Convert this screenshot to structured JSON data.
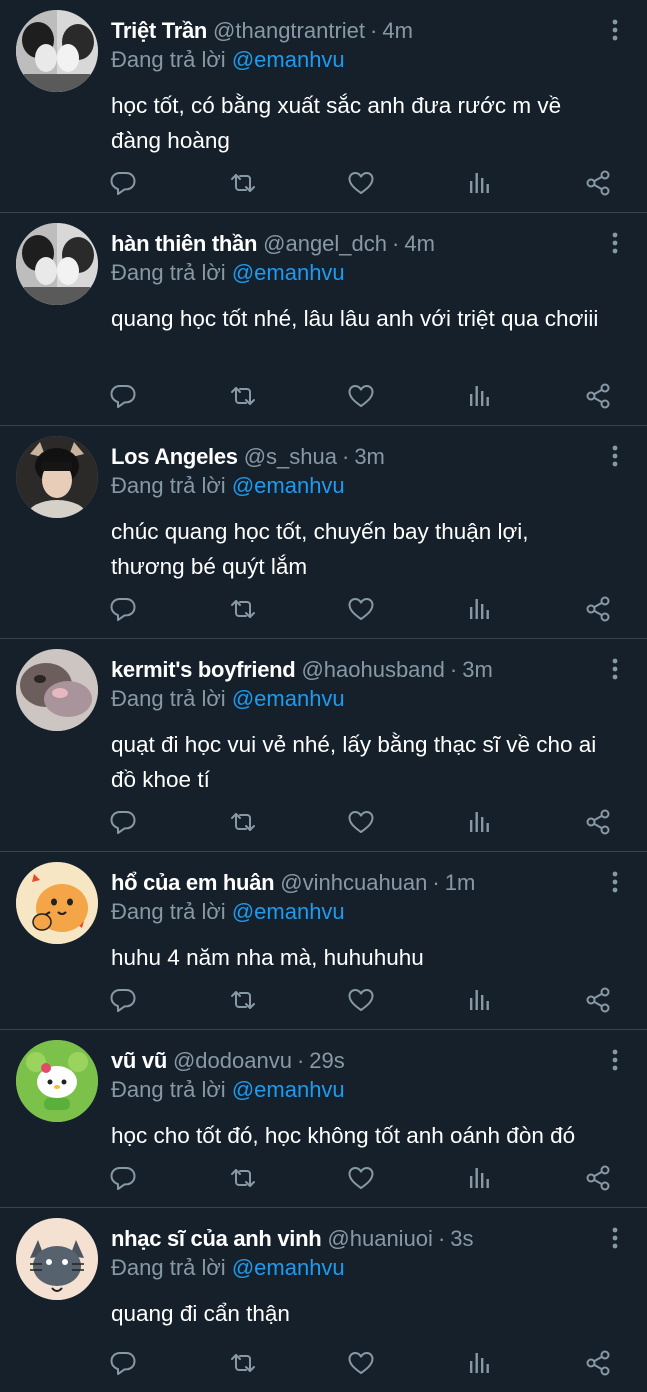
{
  "colors": {
    "background": "#15202b",
    "divider": "#38444d",
    "muted": "#8899a6",
    "mention": "#1d9bf0",
    "text": "#ffffff"
  },
  "tweets": [
    {
      "name": "Triệt Trần",
      "handle": "@thangtrantriet",
      "separator": "·",
      "time": "4m",
      "reply_prefix": "Đang trả lời",
      "reply_to": "@emanhvu",
      "text": "học tốt, có bằng xuất sắc anh đưa rước m về đàng hoàng",
      "avatar_icon": "bw-couple-photo"
    },
    {
      "name": "hàn thiên thần",
      "handle": "@angel_dch",
      "separator": "·",
      "time": "4m",
      "reply_prefix": "Đang trả lời",
      "reply_to": "@emanhvu",
      "text": "quang học tốt nhé, lâu lâu anh với triệt qua chơiii",
      "avatar_icon": "bw-couple-photo"
    },
    {
      "name": "Los Angeles",
      "handle": "@s_shua",
      "separator": "·",
      "time": "3m",
      "reply_prefix": "Đang trả lời",
      "reply_to": "@emanhvu",
      "text": "chúc quang học tốt, chuyến bay thuận lợi, thương bé quýt lắm",
      "avatar_icon": "person-with-ears-photo"
    },
    {
      "name": "kermit's boyfriend",
      "handle": "@haohusband",
      "separator": "·",
      "time": "3m",
      "reply_prefix": "Đang trả lời",
      "reply_to": "@emanhvu",
      "text": "quạt đi học vui vẻ nhé, lấy bằng thạc sĩ về cho ai đồ khoe tí",
      "avatar_icon": "blurry-cat-photo"
    },
    {
      "name": "hổ của em huân",
      "handle": "@vinhcuahuan",
      "separator": "·",
      "time": "1m",
      "reply_prefix": "Đang trả lời",
      "reply_to": "@emanhvu",
      "text": "huhu 4 năm nha mà, huhuhuhu",
      "avatar_icon": "cartoon-tiger"
    },
    {
      "name": "vũ vũ",
      "handle": "@dodoanvu",
      "separator": "·",
      "time": "29s",
      "reply_prefix": "Đang trả lời",
      "reply_to": "@emanhvu",
      "text": "học cho tốt đó, học không tốt anh oánh đòn đó",
      "avatar_icon": "hello-kitty-frog"
    },
    {
      "name": "nhạc sĩ của anh vinh",
      "handle": "@huaniuoi",
      "separator": "·",
      "time": "3s",
      "reply_prefix": "Đang trả lời",
      "reply_to": "@emanhvu",
      "text": "quang đi cẩn thận",
      "avatar_icon": "cartoon-cat"
    }
  ]
}
